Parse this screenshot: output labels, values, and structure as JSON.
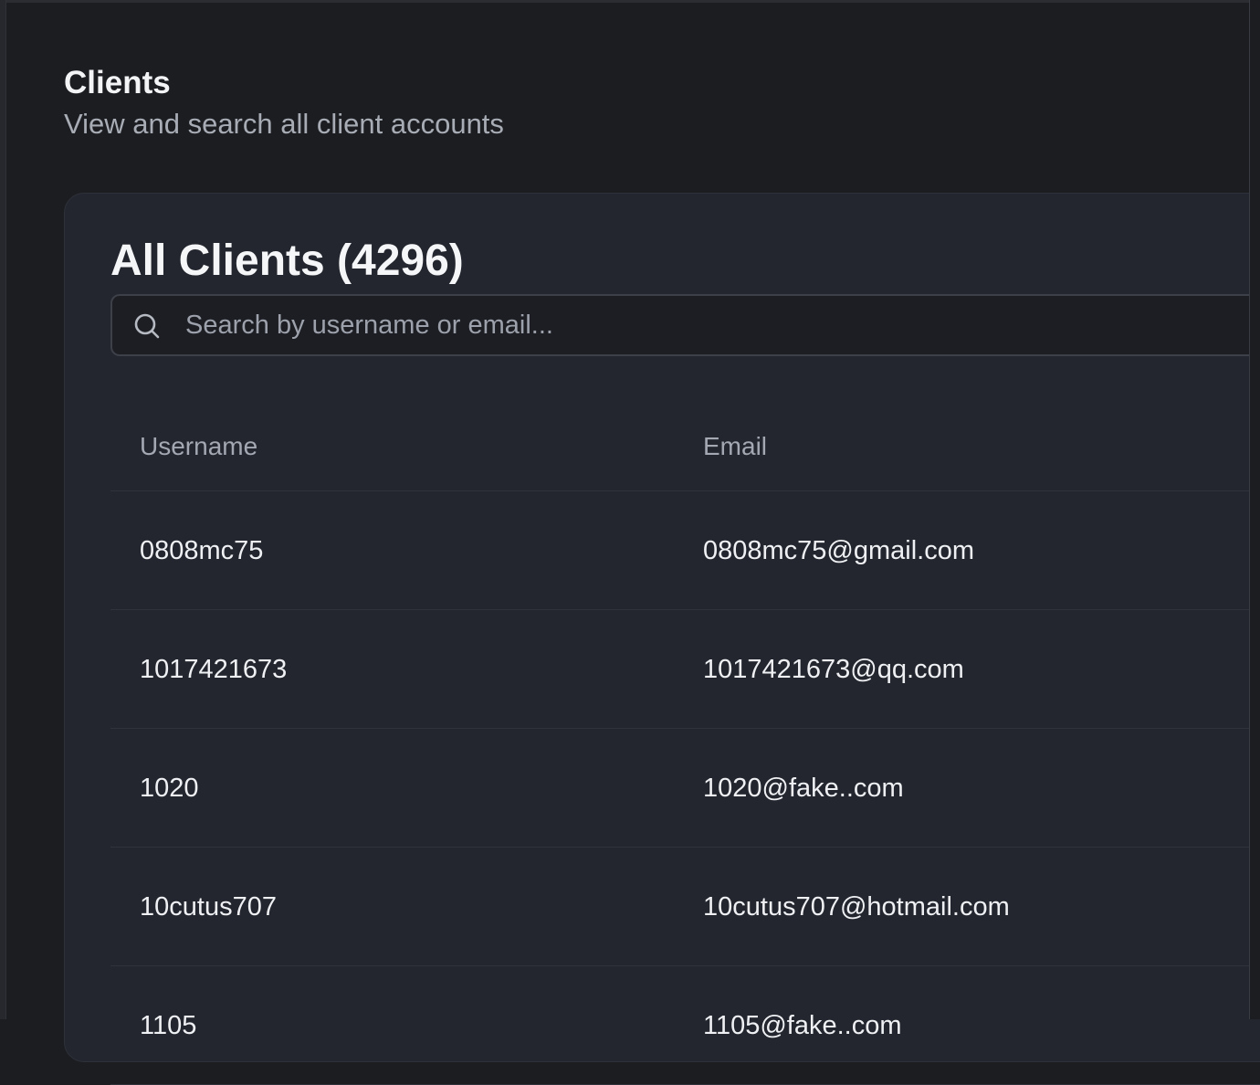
{
  "page": {
    "title": "Clients",
    "subtitle": "View and search all client accounts"
  },
  "card": {
    "title": "All Clients (4296)"
  },
  "search": {
    "icon": "search-icon",
    "placeholder": "Search by username or email...",
    "value": ""
  },
  "table": {
    "columns": [
      "Username",
      "Email"
    ],
    "rows": [
      {
        "username": "0808mc75",
        "email": "0808mc75@gmail.com"
      },
      {
        "username": "1017421673",
        "email": "1017421673@qq.com"
      },
      {
        "username": "1020",
        "email": "1020@fake..com"
      },
      {
        "username": "10cutus707",
        "email": "10cutus707@hotmail.com"
      },
      {
        "username": "1105",
        "email": "1105@fake..com"
      }
    ]
  },
  "colors": {
    "background": "#1c1d21",
    "card": "#23262e",
    "text_primary": "#f3f4f6",
    "text_muted": "#a7acb5"
  }
}
